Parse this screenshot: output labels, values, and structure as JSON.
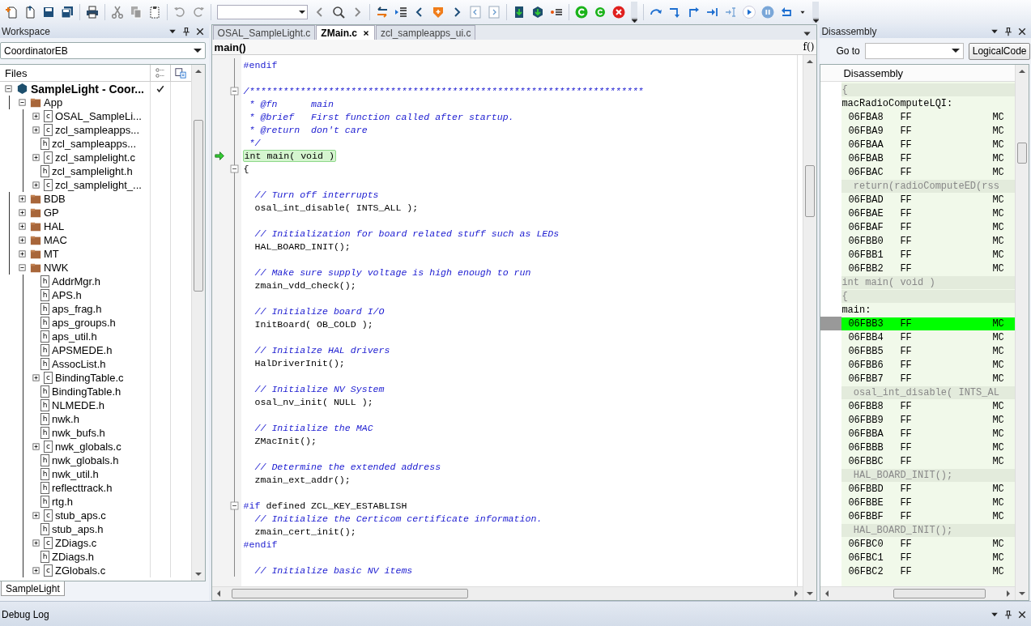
{
  "workspace": {
    "title": "Workspace",
    "configuration": "CoordinatorEB",
    "column": "Files",
    "project": {
      "kind": "project",
      "label": "SampleLight - Coor...",
      "checked": true,
      "expanded": true,
      "children": [
        {
          "kind": "folder",
          "label": "App",
          "expanded": true,
          "children": [
            {
              "kind": "file",
              "badge": "c",
              "label": "OSAL_SampleLi...",
              "expanded": false
            },
            {
              "kind": "file",
              "badge": "c",
              "label": "zcl_sampleapps...",
              "expanded": false
            },
            {
              "kind": "file",
              "badge": "h",
              "label": "zcl_sampleapps..."
            },
            {
              "kind": "file",
              "badge": "c",
              "label": "zcl_samplelight.c",
              "expanded": false
            },
            {
              "kind": "file",
              "badge": "h",
              "label": "zcl_samplelight.h"
            },
            {
              "kind": "file",
              "badge": "c",
              "label": "zcl_samplelight_...",
              "expanded": false
            }
          ]
        },
        {
          "kind": "folder",
          "label": "BDB",
          "expanded": false
        },
        {
          "kind": "folder",
          "label": "GP",
          "expanded": false
        },
        {
          "kind": "folder",
          "label": "HAL",
          "expanded": false
        },
        {
          "kind": "folder",
          "label": "MAC",
          "expanded": false
        },
        {
          "kind": "folder",
          "label": "MT",
          "expanded": false
        },
        {
          "kind": "folder",
          "label": "NWK",
          "expanded": true,
          "children": [
            {
              "kind": "file",
              "badge": "h",
              "label": "AddrMgr.h"
            },
            {
              "kind": "file",
              "badge": "h",
              "label": "APS.h"
            },
            {
              "kind": "file",
              "badge": "h",
              "label": "aps_frag.h"
            },
            {
              "kind": "file",
              "badge": "h",
              "label": "aps_groups.h"
            },
            {
              "kind": "file",
              "badge": "h",
              "label": "aps_util.h"
            },
            {
              "kind": "file",
              "badge": "h",
              "label": "APSMEDE.h"
            },
            {
              "kind": "file",
              "badge": "h",
              "label": "AssocList.h"
            },
            {
              "kind": "file",
              "badge": "c",
              "label": "BindingTable.c",
              "expanded": false
            },
            {
              "kind": "file",
              "badge": "h",
              "label": "BindingTable.h"
            },
            {
              "kind": "file",
              "badge": "h",
              "label": "NLMEDE.h"
            },
            {
              "kind": "file",
              "badge": "h",
              "label": "nwk.h"
            },
            {
              "kind": "file",
              "badge": "h",
              "label": "nwk_bufs.h"
            },
            {
              "kind": "file",
              "badge": "c",
              "label": "nwk_globals.c",
              "expanded": false
            },
            {
              "kind": "file",
              "badge": "h",
              "label": "nwk_globals.h"
            },
            {
              "kind": "file",
              "badge": "h",
              "label": "nwk_util.h"
            },
            {
              "kind": "file",
              "badge": "h",
              "label": "reflecttrack.h"
            },
            {
              "kind": "file",
              "badge": "h",
              "label": "rtg.h"
            },
            {
              "kind": "file",
              "badge": "c",
              "label": "stub_aps.c",
              "expanded": false
            },
            {
              "kind": "file",
              "badge": "h",
              "label": "stub_aps.h"
            },
            {
              "kind": "file",
              "badge": "c",
              "label": "ZDiags.c",
              "expanded": false
            },
            {
              "kind": "file",
              "badge": "h",
              "label": "ZDiags.h"
            },
            {
              "kind": "file",
              "badge": "c",
              "label": "ZGlobals.c",
              "expanded": false
            }
          ]
        }
      ]
    },
    "tabs": [
      {
        "label": "SampleLight",
        "selected": true
      }
    ]
  },
  "editor": {
    "tabs": [
      {
        "label": "OSAL_SampleLight.c",
        "selected": false
      },
      {
        "label": "ZMain.c",
        "selected": true
      },
      {
        "label": "zcl_sampleapps_ui.c",
        "selected": false
      }
    ],
    "function": "main()",
    "function_button": "f()",
    "lines": [
      {
        "kind": "directive",
        "directive": "#endif",
        "fold": false,
        "current": false
      },
      {
        "kind": "blank",
        "fold": false,
        "current": false
      },
      {
        "kind": "comment",
        "text": "/**********************************************************************",
        "fold": true,
        "current": false
      },
      {
        "kind": "comment",
        "text": " * @fn      main",
        "fold": false,
        "current": false
      },
      {
        "kind": "comment",
        "text": " * @brief   First function called after startup.",
        "fold": false,
        "current": false
      },
      {
        "kind": "comment",
        "text": " * @return  don't care",
        "fold": false,
        "current": false
      },
      {
        "kind": "comment",
        "text": " */",
        "fold": false,
        "current": false
      },
      {
        "kind": "code",
        "text": "int main( void )",
        "fold": false,
        "current": true
      },
      {
        "kind": "code",
        "text": "{",
        "fold": true,
        "current": false
      },
      {
        "kind": "blank",
        "fold": false,
        "current": false
      },
      {
        "kind": "comment",
        "text": "  // Turn off interrupts",
        "fold": false,
        "current": false
      },
      {
        "kind": "code",
        "text": "  osal_int_disable( INTS_ALL );",
        "fold": false,
        "current": false
      },
      {
        "kind": "blank",
        "fold": false,
        "current": false
      },
      {
        "kind": "comment",
        "text": "  // Initialization for board related stuff such as LEDs",
        "fold": false,
        "current": false
      },
      {
        "kind": "code",
        "text": "  HAL_BOARD_INIT();",
        "fold": false,
        "current": false
      },
      {
        "kind": "blank",
        "fold": false,
        "current": false
      },
      {
        "kind": "comment",
        "text": "  // Make sure supply voltage is high enough to run",
        "fold": false,
        "current": false
      },
      {
        "kind": "code",
        "text": "  zmain_vdd_check();",
        "fold": false,
        "current": false
      },
      {
        "kind": "blank",
        "fold": false,
        "current": false
      },
      {
        "kind": "comment",
        "text": "  // Initialize board I/O",
        "fold": false,
        "current": false
      },
      {
        "kind": "code",
        "text": "  InitBoard( OB_COLD );",
        "fold": false,
        "current": false
      },
      {
        "kind": "blank",
        "fold": false,
        "current": false
      },
      {
        "kind": "comment",
        "text": "  // Initialze HAL drivers",
        "fold": false,
        "current": false
      },
      {
        "kind": "code",
        "text": "  HalDriverInit();",
        "fold": false,
        "current": false
      },
      {
        "kind": "blank",
        "fold": false,
        "current": false
      },
      {
        "kind": "comment",
        "text": "  // Initialize NV System",
        "fold": false,
        "current": false
      },
      {
        "kind": "code",
        "text": "  osal_nv_init( NULL );",
        "fold": false,
        "current": false
      },
      {
        "kind": "blank",
        "fold": false,
        "current": false
      },
      {
        "kind": "comment",
        "text": "  // Initialize the MAC",
        "fold": false,
        "current": false
      },
      {
        "kind": "code",
        "text": "  ZMacInit();",
        "fold": false,
        "current": false
      },
      {
        "kind": "blank",
        "fold": false,
        "current": false
      },
      {
        "kind": "comment",
        "text": "  // Determine the extended address",
        "fold": false,
        "current": false
      },
      {
        "kind": "code",
        "text": "  zmain_ext_addr();",
        "fold": false,
        "current": false
      },
      {
        "kind": "blank",
        "fold": false,
        "current": false
      },
      {
        "kind": "directive",
        "directive": "#if",
        "text": " defined ZCL_KEY_ESTABLISH",
        "fold": true,
        "current": false
      },
      {
        "kind": "comment",
        "text": "  // Initialize the Certicom certificate information.",
        "fold": false,
        "current": false
      },
      {
        "kind": "code",
        "text": "  zmain_cert_init();",
        "fold": false,
        "current": false
      },
      {
        "kind": "directive",
        "directive": "#endif",
        "fold": false,
        "current": false
      },
      {
        "kind": "blank",
        "fold": false,
        "current": false
      },
      {
        "kind": "comment",
        "text": "  // Initialize basic NV items",
        "fold": false,
        "current": false
      }
    ]
  },
  "disassembly": {
    "title": "Disassembly",
    "goto_label": "Go to",
    "mode_button": "LogicalCode",
    "column": "Disassembly",
    "rows": [
      {
        "kind": "source",
        "text": "{"
      },
      {
        "kind": "label",
        "text": "macRadioComputeLQI:"
      },
      {
        "kind": "instr",
        "address": "06FBA8",
        "bytes": "FF",
        "mnemonic": "MC",
        "current": false
      },
      {
        "kind": "instr",
        "address": "06FBA9",
        "bytes": "FF",
        "mnemonic": "MC",
        "current": false
      },
      {
        "kind": "instr",
        "address": "06FBAA",
        "bytes": "FF",
        "mnemonic": "MC",
        "current": false
      },
      {
        "kind": "instr",
        "address": "06FBAB",
        "bytes": "FF",
        "mnemonic": "MC",
        "current": false
      },
      {
        "kind": "instr",
        "address": "06FBAC",
        "bytes": "FF",
        "mnemonic": "MC",
        "current": false
      },
      {
        "kind": "source",
        "text": "  return(radioComputeED(rss"
      },
      {
        "kind": "instr",
        "address": "06FBAD",
        "bytes": "FF",
        "mnemonic": "MC",
        "current": false
      },
      {
        "kind": "instr",
        "address": "06FBAE",
        "bytes": "FF",
        "mnemonic": "MC",
        "current": false
      },
      {
        "kind": "instr",
        "address": "06FBAF",
        "bytes": "FF",
        "mnemonic": "MC",
        "current": false
      },
      {
        "kind": "instr",
        "address": "06FBB0",
        "bytes": "FF",
        "mnemonic": "MC",
        "current": false
      },
      {
        "kind": "instr",
        "address": "06FBB1",
        "bytes": "FF",
        "mnemonic": "MC",
        "current": false
      },
      {
        "kind": "instr",
        "address": "06FBB2",
        "bytes": "FF",
        "mnemonic": "MC",
        "current": false
      },
      {
        "kind": "source",
        "text": "int main( void )"
      },
      {
        "kind": "source",
        "text": "{"
      },
      {
        "kind": "label",
        "text": "main:"
      },
      {
        "kind": "instr",
        "address": "06FBB3",
        "bytes": "FF",
        "mnemonic": "MC",
        "current": true
      },
      {
        "kind": "instr",
        "address": "06FBB4",
        "bytes": "FF",
        "mnemonic": "MC",
        "current": false
      },
      {
        "kind": "instr",
        "address": "06FBB5",
        "bytes": "FF",
        "mnemonic": "MC",
        "current": false
      },
      {
        "kind": "instr",
        "address": "06FBB6",
        "bytes": "FF",
        "mnemonic": "MC",
        "current": false
      },
      {
        "kind": "instr",
        "address": "06FBB7",
        "bytes": "FF",
        "mnemonic": "MC",
        "current": false
      },
      {
        "kind": "source",
        "text": "  osal_int_disable( INTS_AL"
      },
      {
        "kind": "instr",
        "address": "06FBB8",
        "bytes": "FF",
        "mnemonic": "MC",
        "current": false
      },
      {
        "kind": "instr",
        "address": "06FBB9",
        "bytes": "FF",
        "mnemonic": "MC",
        "current": false
      },
      {
        "kind": "instr",
        "address": "06FBBA",
        "bytes": "FF",
        "mnemonic": "MC",
        "current": false
      },
      {
        "kind": "instr",
        "address": "06FBBB",
        "bytes": "FF",
        "mnemonic": "MC",
        "current": false
      },
      {
        "kind": "instr",
        "address": "06FBBC",
        "bytes": "FF",
        "mnemonic": "MC",
        "current": false
      },
      {
        "kind": "source",
        "text": "  HAL_BOARD_INIT();"
      },
      {
        "kind": "instr",
        "address": "06FBBD",
        "bytes": "FF",
        "mnemonic": "MC",
        "current": false
      },
      {
        "kind": "instr",
        "address": "06FBBE",
        "bytes": "FF",
        "mnemonic": "MC",
        "current": false
      },
      {
        "kind": "instr",
        "address": "06FBBF",
        "bytes": "FF",
        "mnemonic": "MC",
        "current": false
      },
      {
        "kind": "source",
        "text": "  HAL_BOARD_INIT();"
      },
      {
        "kind": "instr",
        "address": "06FBC0",
        "bytes": "FF",
        "mnemonic": "MC",
        "current": false
      },
      {
        "kind": "instr",
        "address": "06FBC1",
        "bytes": "FF",
        "mnemonic": "MC",
        "current": false
      },
      {
        "kind": "instr",
        "address": "06FBC2",
        "bytes": "FF",
        "mnemonic": "MC",
        "current": false
      }
    ]
  },
  "debug_log": {
    "title": "Debug Log"
  }
}
